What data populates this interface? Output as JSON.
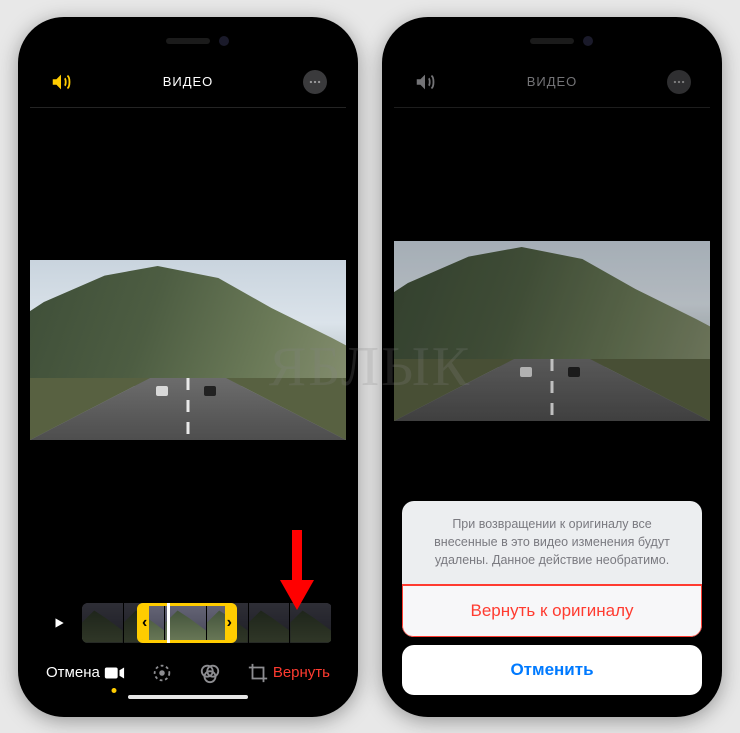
{
  "watermark": "ЯБЛЫК",
  "left": {
    "header": {
      "title": "ВИДЕО"
    },
    "toolbar": {
      "cancel": "Отмена",
      "revert": "Вернуть"
    }
  },
  "right": {
    "header": {
      "title": "ВИДЕО"
    },
    "sheet": {
      "message": "При возвращении к оригиналу все внесенные в это видео изменения будут удалены. Данное действие необратимо.",
      "revert": "Вернуть к оригиналу",
      "cancel": "Отменить"
    }
  }
}
